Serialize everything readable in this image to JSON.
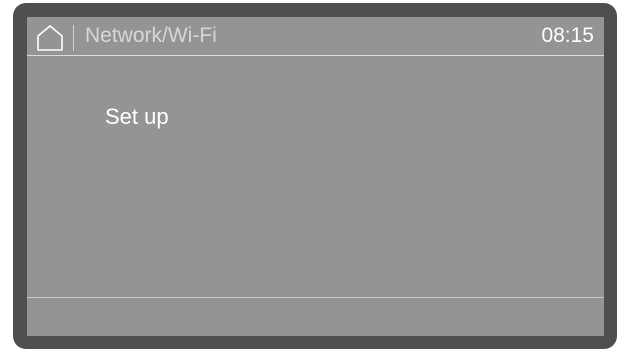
{
  "header": {
    "home_icon": "home-icon",
    "title": "Network/Wi-Fi",
    "time": "08:15"
  },
  "menu": {
    "items": [
      {
        "label": "Set up"
      }
    ]
  },
  "colors": {
    "bezel": "#4f4f51",
    "screen": "#939496",
    "text_primary": "#ffffff",
    "text_secondary": "#d6d7d9"
  }
}
